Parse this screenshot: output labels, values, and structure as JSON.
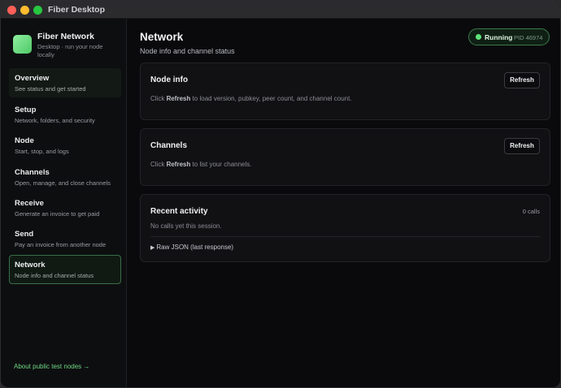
{
  "window": {
    "title": "Fiber Desktop"
  },
  "brand": {
    "name": "Fiber Network",
    "subtitle": "Desktop · run your node locally"
  },
  "sidebar": {
    "items": [
      {
        "label": "Overview",
        "sub": "See status and get started"
      },
      {
        "label": "Setup",
        "sub": "Network, folders, and security"
      },
      {
        "label": "Node",
        "sub": "Start, stop, and logs"
      },
      {
        "label": "Channels",
        "sub": "Open, manage, and close channels"
      },
      {
        "label": "Receive",
        "sub": "Generate an invoice to get paid"
      },
      {
        "label": "Send",
        "sub": "Pay an invoice from another node"
      },
      {
        "label": "Network",
        "sub": "Node info and channel status"
      }
    ],
    "active": "Network",
    "about_link": "About public test nodes →"
  },
  "page": {
    "title": "Network",
    "subtitle": "Node info and channel status"
  },
  "status": {
    "label": "Running",
    "pid": "PID 46974",
    "color": "#5fe37a"
  },
  "cards": {
    "node_info": {
      "title": "Node info",
      "button": "Refresh",
      "text_pre": "Click ",
      "text_bold": "Refresh",
      "text_post": " to load version, pubkey, peer count, and channel count."
    },
    "channels": {
      "title": "Channels",
      "button": "Refresh",
      "text_pre": "Click ",
      "text_bold": "Refresh",
      "text_post": " to list your channels."
    },
    "recent_activity": {
      "title": "Recent activity",
      "count": "0 calls",
      "empty": "No calls yet this session.",
      "raw_json": "Raw JSON (last response)"
    }
  },
  "icons": {
    "disclosure": "triangle-right-icon",
    "status": "status-dot-icon",
    "logo": "fiber-logo-icon"
  },
  "colors": {
    "accent": "#6fd883",
    "background": "#0a0a0c",
    "card": "#111114"
  }
}
